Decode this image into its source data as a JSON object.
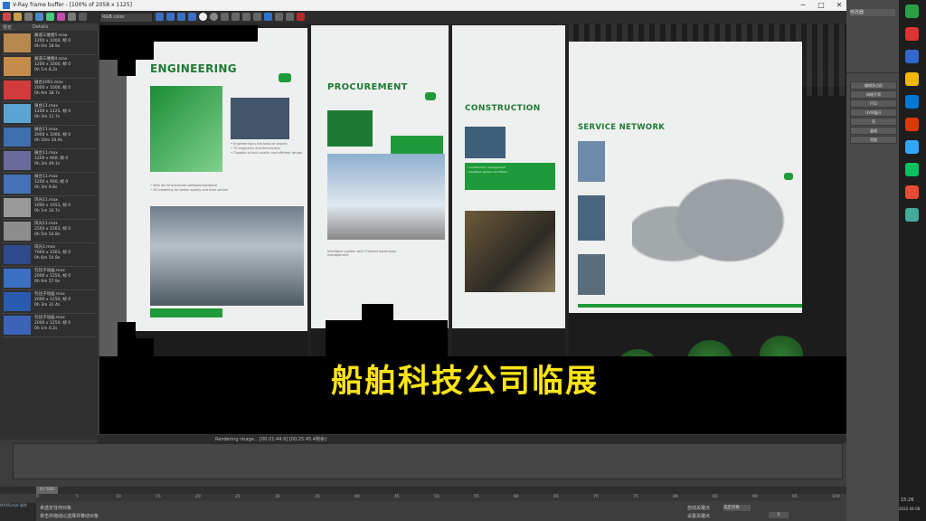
{
  "window": {
    "title": "V-Ray frame buffer - [100% of 2058 x 1125]",
    "minimize": "─",
    "maximize": "□",
    "close": "✕"
  },
  "toolbar": {
    "channel_select": "RGB color"
  },
  "history": {
    "col_preview": "预览",
    "col_details": "Details",
    "items": [
      {
        "name": "廊道三维图5.max",
        "size": "1200 x 1000, 帧 0",
        "time": "0h 0m 18.9s",
        "color": "#b7884e"
      },
      {
        "name": "廊道三维图4.max",
        "size": "1200 x 1000, 帧 0",
        "time": "0h 1m 8.2s",
        "color": "#c58b4a"
      },
      {
        "name": "展台1001.max",
        "size": "2000 x 1000, 帧 0",
        "time": "0h 9m 38.7s",
        "color": "#d23b3b"
      },
      {
        "name": "展台11.max",
        "size": "1200 x 1125, 帧 0",
        "time": "0h 3m 11.7s",
        "color": "#5aa5d4"
      },
      {
        "name": "展台11.max",
        "size": "2000 x 1000, 帧 0",
        "time": "0h 16m 20.9s",
        "color": "#3e6fae"
      },
      {
        "name": "展台11.max",
        "size": "1200 x 900, 帧 0",
        "time": "0h 3m 49.1s",
        "color": "#6a6a9a"
      },
      {
        "name": "展台11.max",
        "size": "1200 x 900, 帧 0",
        "time": "0h 3m 9.8s",
        "color": "#4572b8"
      },
      {
        "name": "风光11.max",
        "size": "1000 x 1053, 帧 0",
        "time": "0h 1m 33.7s",
        "color": "#9a9a9a"
      },
      {
        "name": "风光11.max",
        "size": "2500 x 1563, 帧 0",
        "time": "0h 5m 54.8s",
        "color": "#8d8d8d"
      },
      {
        "name": "风光1.max",
        "size": "7000 x 1563, 帧 0",
        "time": "0h 6m 54.8s",
        "color": "#2e4a8a"
      },
      {
        "name": "包括子动画.max",
        "size": "2000 x 1250, 帧 0",
        "time": "0h 6m 57.9s",
        "color": "#3a6fc4"
      },
      {
        "name": "包括子动画.max",
        "size": "2000 x 1250, 帧 0",
        "time": "0h 3m 31.4s",
        "color": "#2b5bb0"
      },
      {
        "name": "包括子动画.max",
        "size": "2000 x 1250, 帧 0",
        "time": "0h 1m 0.2s",
        "color": "#3d63b8"
      }
    ]
  },
  "scene": {
    "panels": [
      {
        "title": "ENGINEERING",
        "bullets": "• Engineering is the basis of project\n• 70 engineers and technicians\n• Capable of bulk quality and efficient design",
        "bottom": "• With aid of advanced software/hardware\n• 3D modeling for better quality and time control"
      },
      {
        "title": "PROCUREMENT",
        "bottom": "Intelligent system with IT-based warehouse management"
      },
      {
        "title": "CONSTRUCTION",
        "bullets": "• Construction management\n• Qualified welders and fitters"
      },
      {
        "title": "SERVICE NETWORK"
      }
    ],
    "subtitle": "船舶科技公司临展"
  },
  "status": {
    "text": "Rendering image... [00:21:44.9] [00:25:45.4剩余]"
  },
  "right_panel": {
    "tab_label": "修改器",
    "buttons": [
      "编辑多边形",
      "网格平滑",
      "FFD",
      "UVW展开",
      "壳",
      "晶格",
      "弯曲"
    ]
  },
  "taskbar": {
    "time": "15:26",
    "date": "2022-04-08"
  },
  "timeline": {
    "frame_display": "0 / 100",
    "ticks": [
      "0",
      "5",
      "10",
      "15",
      "20",
      "25",
      "30",
      "35",
      "40",
      "45",
      "50",
      "55",
      "60",
      "65",
      "70",
      "75",
      "80",
      "85",
      "90",
      "95",
      "100"
    ],
    "status_line1": "未选定任何对象",
    "status_line2": "单击并拖动以选择并移动对象",
    "maxscript_label": "MAXScript 迷你",
    "autokey": "自动关键点",
    "setkey": "设置关键点",
    "selected": "选定对象",
    "frame_input": "0"
  }
}
